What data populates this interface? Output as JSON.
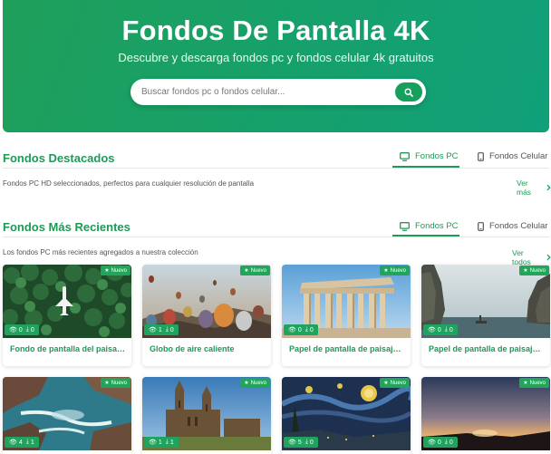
{
  "hero": {
    "title": "Fondos De Pantalla 4K",
    "subtitle": "Descubre y descarga fondos pc y fondos celular 4k gratuitos",
    "search_placeholder": "Buscar fondos pc o fondos celular..."
  },
  "featured": {
    "title": "Fondos Destacados",
    "description": "Fondos PC HD seleccionados, perfectos para cualquier resolución de pantalla",
    "tabs": [
      {
        "label": "Fondos PC",
        "active": true
      },
      {
        "label": "Fondos Celular",
        "active": false
      }
    ],
    "see_more": "Ver más"
  },
  "recent": {
    "title": "Fondos Más Recientes",
    "description": "Los fondos PC más recientes agregados a nuestra colección",
    "tabs": [
      {
        "label": "Fondos PC",
        "active": true
      },
      {
        "label": "Fondos Celular",
        "active": false
      }
    ],
    "see_all": "Ver todos"
  },
  "badge_label": "Nuevo",
  "cards": [
    {
      "title": "Fondo de pantalla del paisaje...",
      "views": "0",
      "downloads": "0",
      "scene": "forest-plane"
    },
    {
      "title": "Globo de aire caliente",
      "views": "1",
      "downloads": "0",
      "scene": "balloons"
    },
    {
      "title": "Papel de pantalla de paisaje ...",
      "views": "0",
      "downloads": "0",
      "scene": "parthenon"
    },
    {
      "title": "Papel de pantalla de paisaje ...",
      "views": "0",
      "downloads": "0",
      "scene": "cliffs-sea"
    },
    {
      "title": "",
      "views": "4",
      "downloads": "1",
      "scene": "ocean-rocks"
    },
    {
      "title": "",
      "views": "1",
      "downloads": "1",
      "scene": "cathedral"
    },
    {
      "title": "",
      "views": "5",
      "downloads": "0",
      "scene": "starry-night"
    },
    {
      "title": "",
      "views": "0",
      "downloads": "0",
      "scene": "sunset"
    }
  ],
  "colors": {
    "brand": "#1d9a56",
    "hero_start": "#1f9f5a",
    "hero_end": "#10a07a",
    "badge": "#22a55a"
  }
}
